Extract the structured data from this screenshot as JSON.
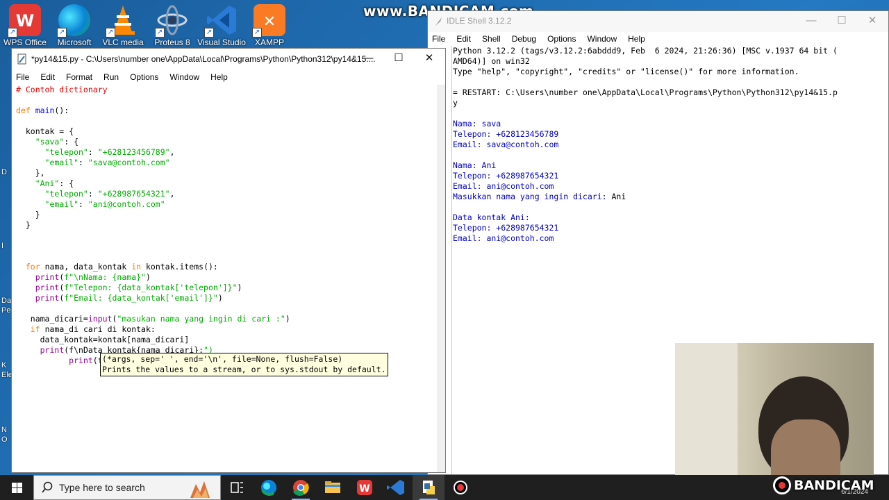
{
  "watermark": "www.BANDICAM.com",
  "desktop": {
    "icons": [
      {
        "label": "WPS Office",
        "color": "#e53935"
      },
      {
        "label": "Microsoft",
        "color": "#0a84d6"
      },
      {
        "label": "VLC media",
        "color": "#ff8800"
      },
      {
        "label": "Proteus 8",
        "color": "#7e8fa6"
      },
      {
        "label": "Visual Studio",
        "color": "#2b7bd6"
      },
      {
        "label": "XAMPP",
        "color": "#fb7a24"
      }
    ],
    "left_fragments": [
      "D",
      "I",
      "Da",
      "Pe",
      "K",
      "Ele",
      "N",
      "O"
    ]
  },
  "editor": {
    "title": "*py14&15.py - C:\\Users\\number one\\AppData\\Local\\Programs\\Python\\Python312\\py14&15....",
    "menu": [
      "File",
      "Edit",
      "Format",
      "Run",
      "Options",
      "Window",
      "Help"
    ],
    "calltip": {
      "line1": "(*args, sep=' ', end='\\n', file=None, flush=False)",
      "line2": "Prints the values to a stream, or to sys.stdout by default."
    }
  },
  "shell": {
    "title": "IDLE Shell 3.12.2",
    "menu": [
      "File",
      "Edit",
      "Shell",
      "Debug",
      "Options",
      "Window",
      "Help"
    ],
    "lines": [
      {
        "text": "Python 3.12.2 (tags/v3.12.2:6abddd9, Feb  6 2024, 21:26:36) [MSC v.1937 64 bit (",
        "cls": ""
      },
      {
        "text": "AMD64)] on win32",
        "cls": ""
      },
      {
        "text": "Type \"help\", \"copyright\", \"credits\" or \"license()\" for more information.",
        "cls": ""
      },
      {
        "text": "",
        "cls": ""
      },
      {
        "text": "= RESTART: C:\\Users\\number one\\AppData\\Local\\Programs\\Python\\Python312\\py14&15.p",
        "cls": ""
      },
      {
        "text": "y",
        "cls": ""
      },
      {
        "text": "",
        "cls": ""
      },
      {
        "text": "Nama: sava",
        "cls": "so"
      },
      {
        "text": "Telepon: +628123456789",
        "cls": "so"
      },
      {
        "text": "Email: sava@contoh.com",
        "cls": "so"
      },
      {
        "text": "",
        "cls": ""
      },
      {
        "text": "Nama: Ani",
        "cls": "so"
      },
      {
        "text": "Telepon: +628987654321",
        "cls": "so"
      },
      {
        "text": "Email: ani@contoh.com",
        "cls": "so"
      },
      {
        "text": "Masukkan nama yang ingin dicari: ",
        "cls": "so",
        "input": "Ani"
      },
      {
        "text": "",
        "cls": ""
      },
      {
        "text": "Data kontak Ani:",
        "cls": "so"
      },
      {
        "text": "Telepon: +628987654321",
        "cls": "so"
      },
      {
        "text": "Email: ani@contoh.com",
        "cls": "so"
      }
    ]
  },
  "bandicam_logo": "BANDICAM",
  "taskbar": {
    "search_placeholder": "Type here to search",
    "date_fragment": "6/1/2024"
  }
}
